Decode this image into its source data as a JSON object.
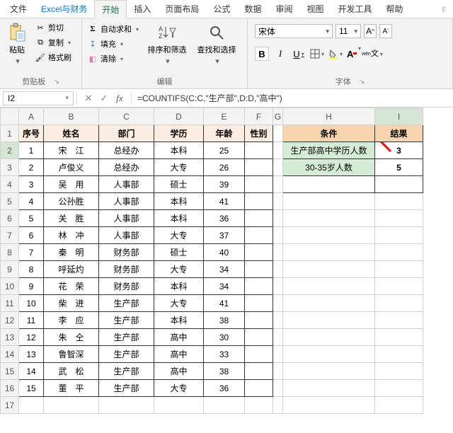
{
  "menu": {
    "file": "文件",
    "excel_finance": "Excel与财务",
    "home": "开始",
    "insert": "插入",
    "page_layout": "页面布局",
    "formulas": "公式",
    "data": "数据",
    "review": "审阅",
    "view": "视图",
    "dev": "开发工具",
    "help": "帮助"
  },
  "ribbon": {
    "clipboard": {
      "paste": "粘贴",
      "cut": "剪切",
      "copy": "复制",
      "painter": "格式刷",
      "label": "剪贴板"
    },
    "editing": {
      "autosum": "自动求和",
      "fill": "填充",
      "clear": "清除",
      "sort_filter": "排序和筛选",
      "find_select": "查找和选择",
      "label": "编辑"
    },
    "font": {
      "name": "宋体",
      "size": "11",
      "label": "字体",
      "wen": "wén",
      "pinyin": "文"
    }
  },
  "namebox": "I2",
  "formula": "=COUNTIFS(C:C,\"生产部\",D:D,\"高中\")",
  "cols": [
    "A",
    "B",
    "C",
    "D",
    "E",
    "F",
    "G",
    "H",
    "I"
  ],
  "headers": {
    "A": "序号",
    "B": "姓名",
    "C": "部门",
    "D": "学历",
    "E": "年龄",
    "F": "性别",
    "H": "条件",
    "I": "结果"
  },
  "rows": [
    {
      "n": "1",
      "name": "宋　江",
      "dept": "总经办",
      "edu": "本科",
      "age": "25"
    },
    {
      "n": "2",
      "name": "卢俊义",
      "dept": "总经办",
      "edu": "大专",
      "age": "26"
    },
    {
      "n": "3",
      "name": "吴　用",
      "dept": "人事部",
      "edu": "硕士",
      "age": "39"
    },
    {
      "n": "4",
      "name": "公孙胜",
      "dept": "人事部",
      "edu": "本科",
      "age": "41"
    },
    {
      "n": "5",
      "name": "关　胜",
      "dept": "人事部",
      "edu": "本科",
      "age": "36"
    },
    {
      "n": "6",
      "name": "林　冲",
      "dept": "人事部",
      "edu": "大专",
      "age": "37"
    },
    {
      "n": "7",
      "name": "秦　明",
      "dept": "财务部",
      "edu": "硕士",
      "age": "40"
    },
    {
      "n": "8",
      "name": "呼延灼",
      "dept": "财务部",
      "edu": "大专",
      "age": "34"
    },
    {
      "n": "9",
      "name": "花　荣",
      "dept": "财务部",
      "edu": "本科",
      "age": "34"
    },
    {
      "n": "10",
      "name": "柴　进",
      "dept": "生产部",
      "edu": "大专",
      "age": "41"
    },
    {
      "n": "11",
      "name": "李　应",
      "dept": "生产部",
      "edu": "本科",
      "age": "38"
    },
    {
      "n": "12",
      "name": "朱　仝",
      "dept": "生产部",
      "edu": "高中",
      "age": "30"
    },
    {
      "n": "13",
      "name": "鲁智深",
      "dept": "生产部",
      "edu": "高中",
      "age": "33"
    },
    {
      "n": "14",
      "name": "武　松",
      "dept": "生产部",
      "edu": "高中",
      "age": "38"
    },
    {
      "n": "15",
      "name": "董　平",
      "dept": "生产部",
      "edu": "大专",
      "age": "36"
    }
  ],
  "conditions": [
    {
      "label": "生产部高中学历人数",
      "result": "3"
    },
    {
      "label": "30-35岁人数",
      "result": "5"
    }
  ]
}
